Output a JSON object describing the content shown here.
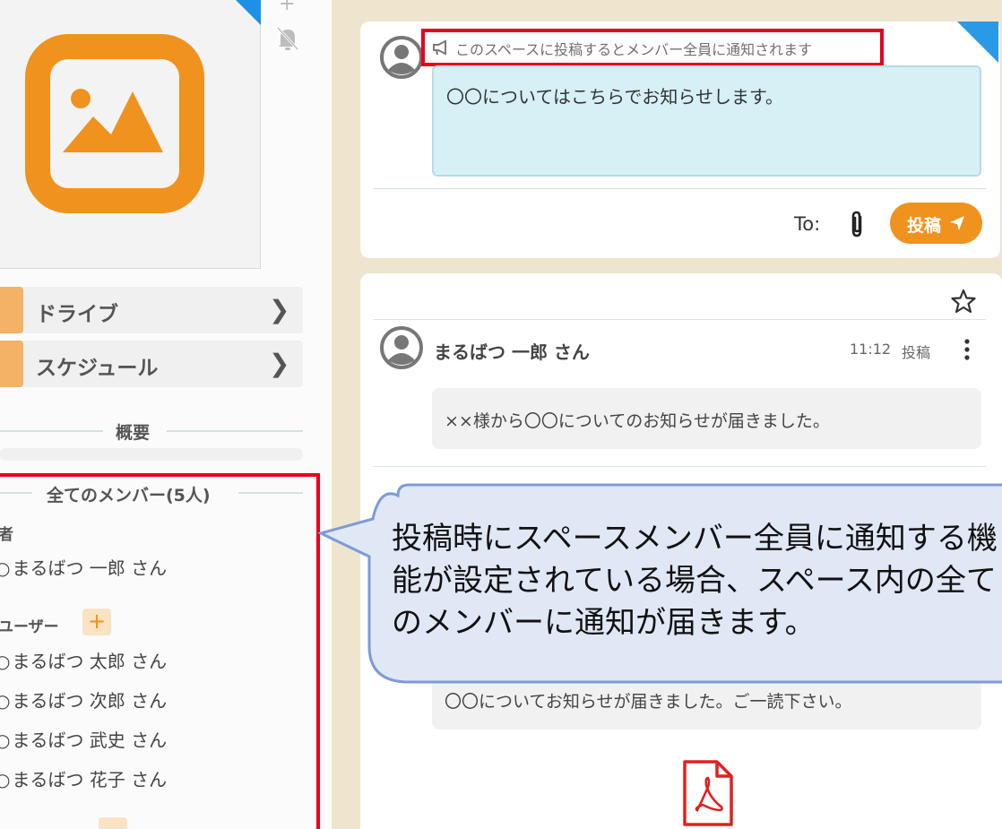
{
  "left_panel": {
    "nav": [
      {
        "label": "ドライブ",
        "icon": "drive-icon"
      },
      {
        "label": "スケジュール",
        "icon": "schedule-icon"
      }
    ],
    "overview_label": "概要",
    "members": {
      "title": "全てのメンバー(5人)",
      "admin_label": "者",
      "admin": "まるばつ 一郎 さん",
      "users_label": "ユーザー",
      "users": [
        "まるばつ 太郎 さん",
        "まるばつ 次郎 さん",
        "まるばつ 武史 さん",
        "まるばつ 花子 さん"
      ],
      "add_symbol": "+"
    }
  },
  "composer": {
    "notice": "このスペースに投稿するとメンバー全員に通知されます",
    "value": "〇〇についてはこちらでお知らせします。",
    "to_label": "To:",
    "post_button": "投稿"
  },
  "feed": {
    "post": {
      "author": "まるばつ 一郎 さん",
      "time": "11:12",
      "kind": "投稿",
      "message": "××様から〇〇についてのお知らせが届きました。"
    },
    "second_message": "〇〇についてお知らせが届きました。ご一読下さい。"
  },
  "callout": {
    "text": "投稿時にスペースメンバー全員に通知する機能が設定されている場合、スペース内の全てのメンバーに通知が届きます。"
  },
  "colors": {
    "accent": "#f0921e",
    "highlight": "#e6001e",
    "callout_fill": "#e0e8f6",
    "callout_border": "#7d9bd6",
    "input_fill": "#d6f0f5"
  }
}
